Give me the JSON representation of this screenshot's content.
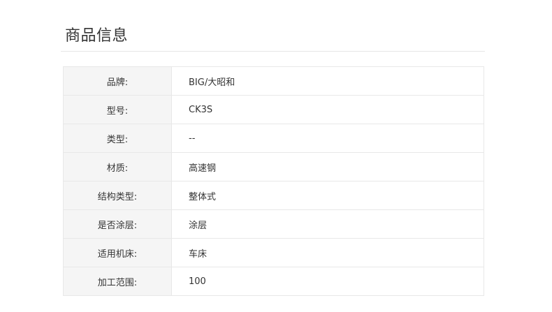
{
  "section": {
    "title": "商品信息"
  },
  "specs": [
    {
      "label": "品牌:",
      "value": "BIG/大昭和"
    },
    {
      "label": "型号:",
      "value": "CK3S"
    },
    {
      "label": "类型:",
      "value": "--"
    },
    {
      "label": "材质:",
      "value": "高速钢"
    },
    {
      "label": "结构类型:",
      "value": "整体式"
    },
    {
      "label": "是否涂层:",
      "value": "涂层"
    },
    {
      "label": "适用机床:",
      "value": "车床"
    },
    {
      "label": "加工范围:",
      "value": "100"
    }
  ]
}
